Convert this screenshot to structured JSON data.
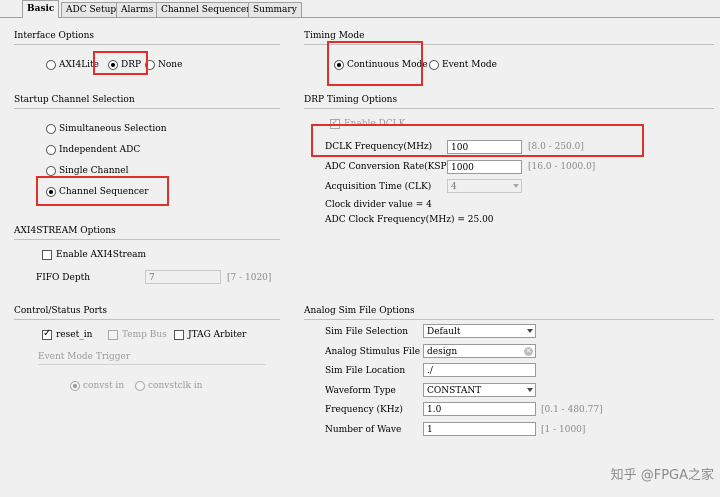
{
  "tabs": [
    "Basic",
    "ADC Setup",
    "Alarms",
    "Channel Sequencer",
    "Summary"
  ],
  "interface": {
    "title": "Interface Options",
    "opt_axi": "AXI4Lite",
    "opt_drp": "DRP",
    "opt_none": "None"
  },
  "timing": {
    "title": "Timing Mode",
    "opt_cont": "Continuous Mode",
    "opt_event": "Event Mode"
  },
  "startup": {
    "title": "Startup Channel Selection",
    "opt_sim": "Simultaneous Selection",
    "opt_indep": "Independent ADC",
    "opt_single": "Single Channel",
    "opt_seq": "Channel Sequencer"
  },
  "drp_timing": {
    "title": "DRP Timing Options",
    "enable_dclk": "Enable DCLK",
    "dclk_label": "DCLK Frequency(MHz)",
    "dclk_value": "100",
    "dclk_range": "[8.0 - 250.0]",
    "conv_label": "ADC Conversion Rate(KSPS)",
    "conv_value": "1000",
    "conv_range": "[16.0 - 1000.0]",
    "acq_label": "Acquisition Time (CLK)",
    "acq_value": "4",
    "clkdiv": "Clock divider value = 4",
    "adcclk": "ADC Clock Frequency(MHz) = 25.00"
  },
  "axi4stream": {
    "title": "AXI4STREAM Options",
    "enable": "Enable AXI4Stream",
    "fifo_label": "FIFO Depth",
    "fifo_value": "7",
    "fifo_range": "[7 - 1020]"
  },
  "ports": {
    "title": "Control/Status Ports",
    "reset": "reset_in",
    "temp": "Temp Bus",
    "jtag": "JTAG Arbiter",
    "event_trigger": "Event Mode Trigger",
    "convst": "convst in",
    "convstclk": "convstclk in"
  },
  "analog": {
    "title": "Analog Sim File Options",
    "sel_label": "Sim File Selection",
    "sel_value": "Default",
    "stim_label": "Analog Stimulus File",
    "stim_value": "design",
    "loc_label": "Sim File Location",
    "loc_value": "./",
    "wave_label": "Waveform Type",
    "wave_value": "CONSTANT",
    "freq_label": "Frequency (KHz)",
    "freq_value": "1.0",
    "freq_range": "[0.1 - 480.77]",
    "num_label": "Number of Wave",
    "num_value": "1",
    "num_range": "[1 - 1000]"
  },
  "watermark": "知乎 @FPGA之家",
  "colors": {
    "highlight": "#e0302a",
    "background": "#f0f0f0"
  }
}
